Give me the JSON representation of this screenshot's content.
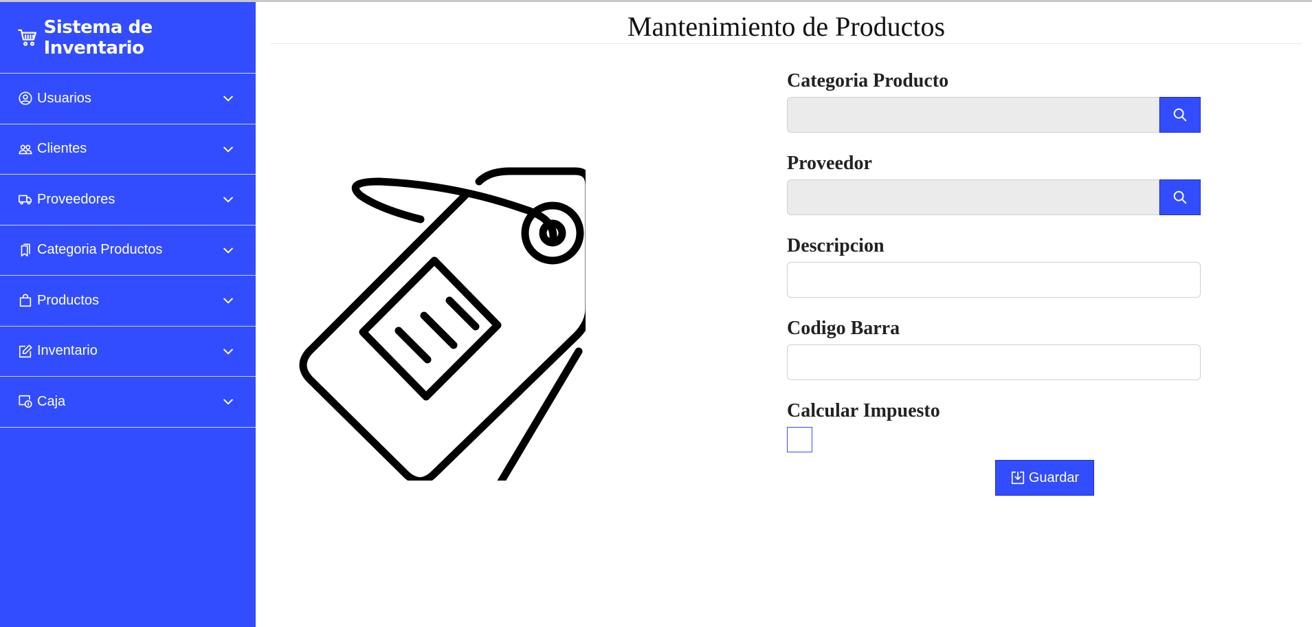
{
  "app": {
    "brand_icon": "cart-icon",
    "brand_title": "Sistema de Inventario",
    "accent_color": "#324dff"
  },
  "sidebar": {
    "items": [
      {
        "label": "Usuarios",
        "icon": "person-circle-icon"
      },
      {
        "label": "Clientes",
        "icon": "people-icon"
      },
      {
        "label": "Proveedores",
        "icon": "truck-icon"
      },
      {
        "label": "Categoria Productos",
        "icon": "bookmarks-icon"
      },
      {
        "label": "Productos",
        "icon": "bag-icon"
      },
      {
        "label": "Inventario",
        "icon": "pencil-square-icon"
      },
      {
        "label": "Caja",
        "icon": "cash-register-icon"
      }
    ]
  },
  "main": {
    "title": "Mantenimiento de Productos",
    "illustration": "price-tag-icon",
    "form": {
      "categoria_label": "Categoria Producto",
      "categoria_value": "",
      "proveedor_label": "Proveedor",
      "proveedor_value": "",
      "descripcion_label": "Descripcion",
      "descripcion_value": "",
      "codigo_label": "Codigo Barra",
      "codigo_value": "",
      "impuesto_label": "Calcular Impuesto",
      "impuesto_checked": false,
      "save_label": "Guardar"
    }
  }
}
